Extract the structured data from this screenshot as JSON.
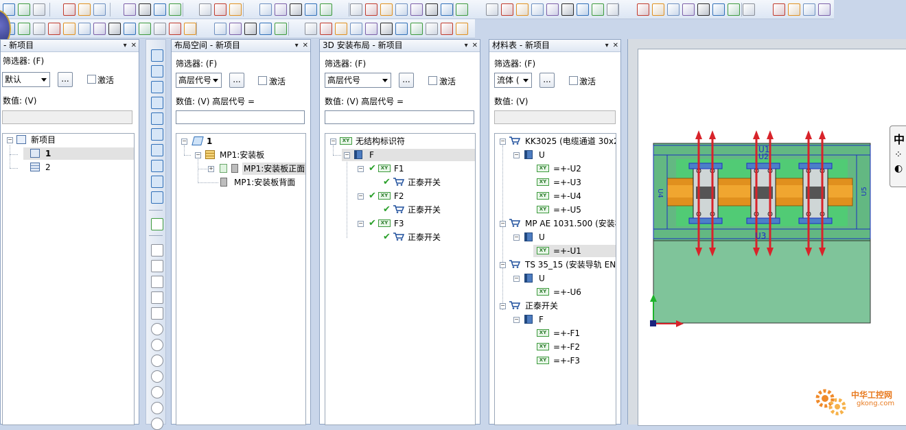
{
  "colors": {
    "accent": "#1e4f9c",
    "check": "#2aa02a",
    "selection": "#e2e2e2",
    "arrow": "#d8232a"
  },
  "panels": {
    "project": {
      "title": "- 新项目",
      "filter_label": "筛选器: (F)",
      "combo_value": "默认",
      "dots_label": "...",
      "active_label": "激活",
      "value_label": "数值: (V)",
      "tree": {
        "root": "新项目",
        "item1": "1",
        "item2": "2"
      }
    },
    "layout": {
      "title": "布局空间 - 新项目",
      "filter_label": "筛选器: (F)",
      "combo_value": "高层代号",
      "dots_label": "...",
      "active_label": "激活",
      "value_label": "数值: (V) 高层代号 =",
      "tree": {
        "root": "1",
        "mp": "MP1:安装板",
        "front": "MP1:安装板正面",
        "back": "MP1:安装板背面"
      }
    },
    "install3d": {
      "title": "3D 安装布局 - 新项目",
      "filter_label": "筛选器: (F)",
      "combo_value": "高层代号",
      "dots_label": "...",
      "active_label": "激活",
      "value_label": "数值: (V) 高层代号 =",
      "tree": {
        "root": "无结构标识符",
        "f": "F",
        "f1": "F1",
        "f1c": "正泰开关",
        "f2": "F2",
        "f2c": "正泰开关",
        "f3": "F3",
        "f3c": "正泰开关"
      }
    },
    "bom": {
      "title": "材料表 - 新项目",
      "filter_label": "筛选器: (F)",
      "combo_value": "流体 (",
      "dots_label": "...",
      "active_label": "激活",
      "value_label": "数值: (V)",
      "tree": {
        "kk": "KK3025 (电缆通道 30x2",
        "u1": "U",
        "u2": "=+-U2",
        "u3": "=+-U3",
        "u4": "=+-U4",
        "u5": "=+-U5",
        "mp": "MP AE 1031.500 (安装板",
        "u_mp": "U",
        "u1v": "=+-U1",
        "ts": "TS 35_15 (安装导轨 EN",
        "u_ts": "U",
        "u6": "=+-U6",
        "zt": "正泰开关",
        "f": "F",
        "f1": "=+-F1",
        "f2": "=+-F2",
        "f3": "=+-F3"
      }
    }
  },
  "canvas": {
    "labels": {
      "u1": "U1",
      "u2": "U2",
      "u3": "U3",
      "u4": "U4",
      "u5": "U5"
    }
  },
  "sidetab": {
    "char": "中"
  },
  "watermark": {
    "cn": "中华工控网",
    "en": "gkong.com"
  }
}
